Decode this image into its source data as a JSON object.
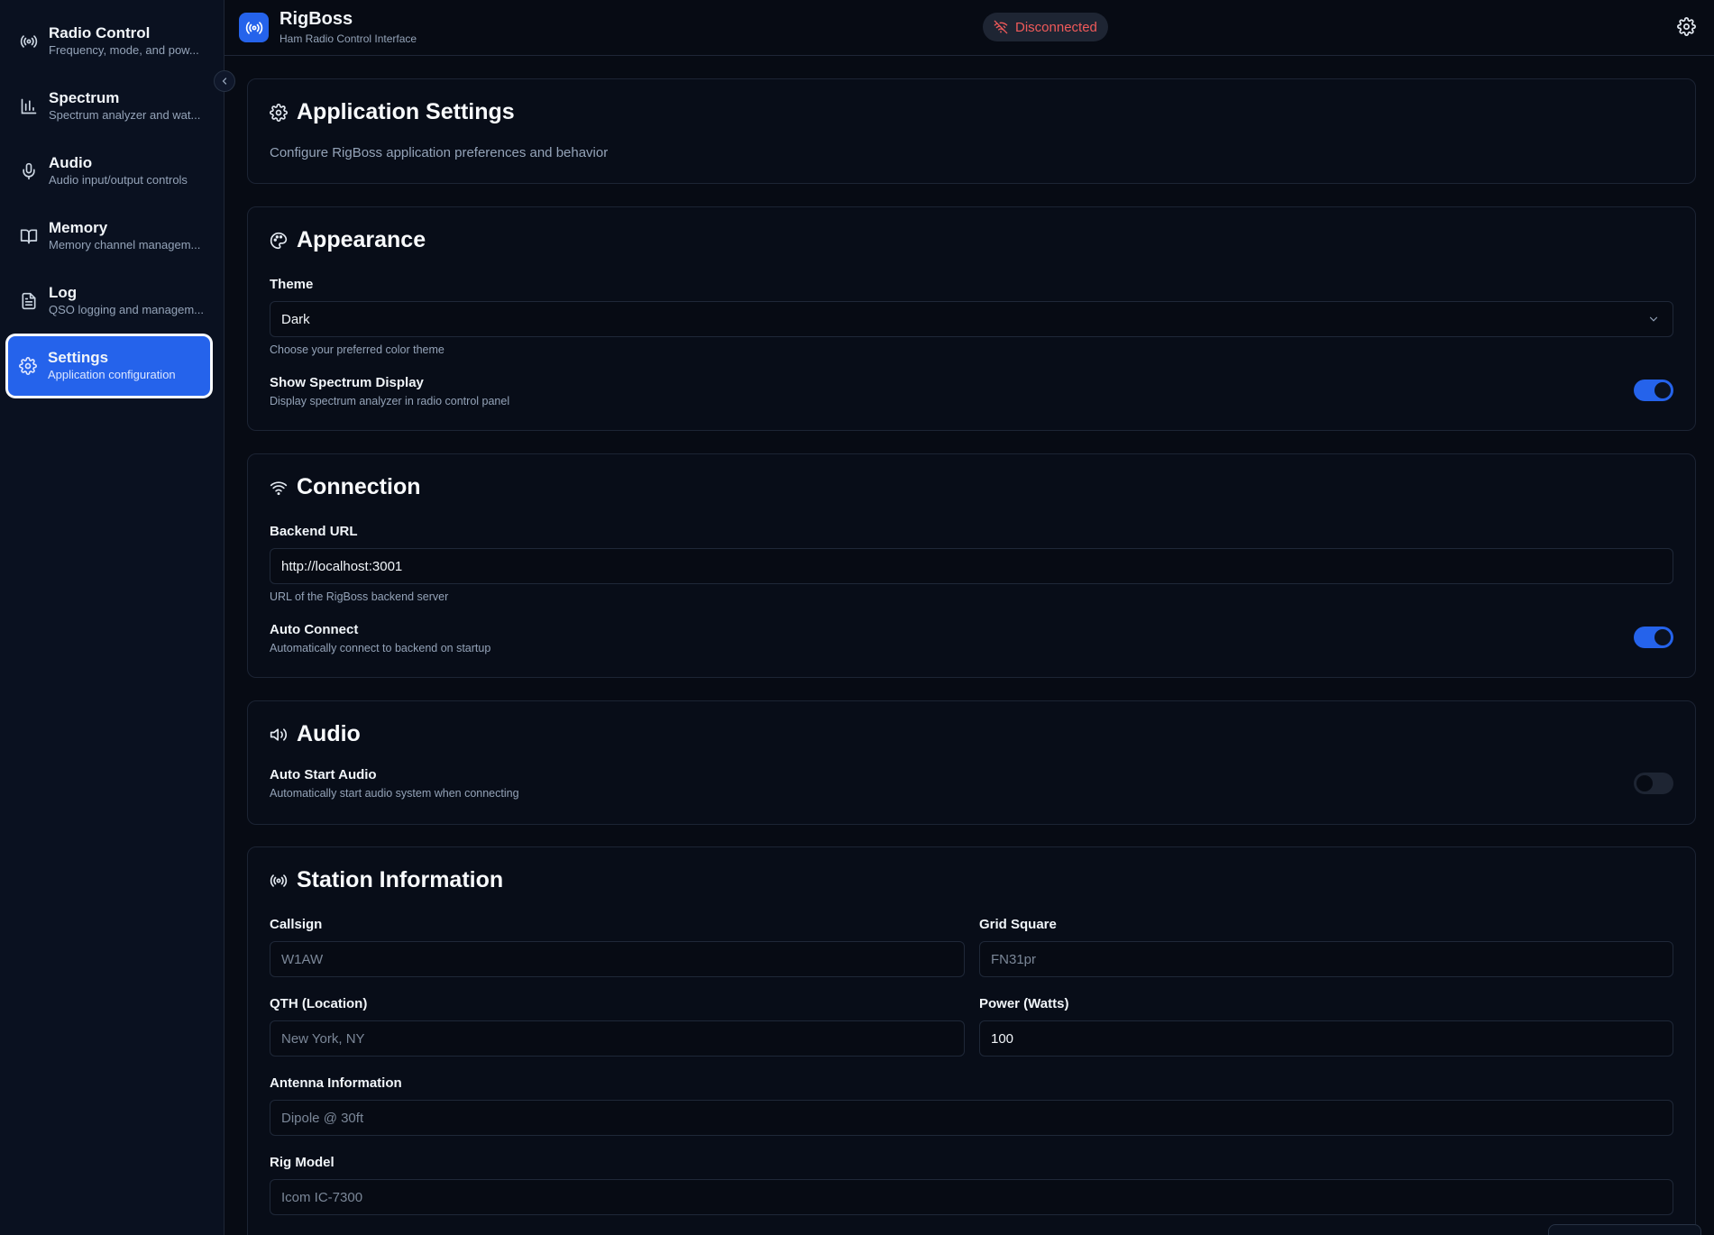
{
  "sidebar": {
    "items": [
      {
        "title": "Radio Control",
        "subtitle": "Frequency, mode, and pow..."
      },
      {
        "title": "Spectrum",
        "subtitle": "Spectrum analyzer and wat..."
      },
      {
        "title": "Audio",
        "subtitle": "Audio input/output controls"
      },
      {
        "title": "Memory",
        "subtitle": "Memory channel managem..."
      },
      {
        "title": "Log",
        "subtitle": "QSO logging and managem..."
      },
      {
        "title": "Settings",
        "subtitle": "Application configuration"
      }
    ],
    "active_index": 5
  },
  "header": {
    "title": "RigBoss",
    "subtitle": "Ham Radio Control Interface",
    "status": "Disconnected"
  },
  "app_settings": {
    "title": "Application Settings",
    "description": "Configure RigBoss application preferences and behavior"
  },
  "appearance": {
    "title": "Appearance",
    "theme_label": "Theme",
    "theme_value": "Dark",
    "theme_help": "Choose your preferred color theme",
    "spectrum_label": "Show Spectrum Display",
    "spectrum_help": "Display spectrum analyzer in radio control panel",
    "spectrum_enabled": true
  },
  "connection": {
    "title": "Connection",
    "backend_label": "Backend URL",
    "backend_value": "http://localhost:3001",
    "backend_help": "URL of the RigBoss backend server",
    "auto_connect_label": "Auto Connect",
    "auto_connect_help": "Automatically connect to backend on startup",
    "auto_connect_enabled": true
  },
  "audio": {
    "title": "Audio",
    "auto_start_label": "Auto Start Audio",
    "auto_start_help": "Automatically start audio system when connecting",
    "auto_start_enabled": false
  },
  "station": {
    "title": "Station Information",
    "callsign_label": "Callsign",
    "callsign_placeholder": "W1AW",
    "grid_label": "Grid Square",
    "grid_placeholder": "FN31pr",
    "qth_label": "QTH (Location)",
    "qth_placeholder": "New York, NY",
    "power_label": "Power (Watts)",
    "power_value": "100",
    "antenna_label": "Antenna Information",
    "antenna_placeholder": "Dipole @ 30ft",
    "rig_label": "Rig Model",
    "rig_placeholder": "Icom IC-7300"
  },
  "colors": {
    "accent": "#2563eb",
    "background": "#070b14",
    "status_error": "#f05a5a"
  },
  "icons": {
    "radio_control": "radio-waves-icon",
    "spectrum": "bar-chart-icon",
    "audio": "microphone-icon",
    "memory": "book-icon",
    "log": "document-icon",
    "settings": "gear-icon",
    "appearance": "palette-icon",
    "connection": "wifi-icon",
    "audio_section": "speaker-icon",
    "station": "radio-waves-icon",
    "status": "wifi-off-icon"
  }
}
